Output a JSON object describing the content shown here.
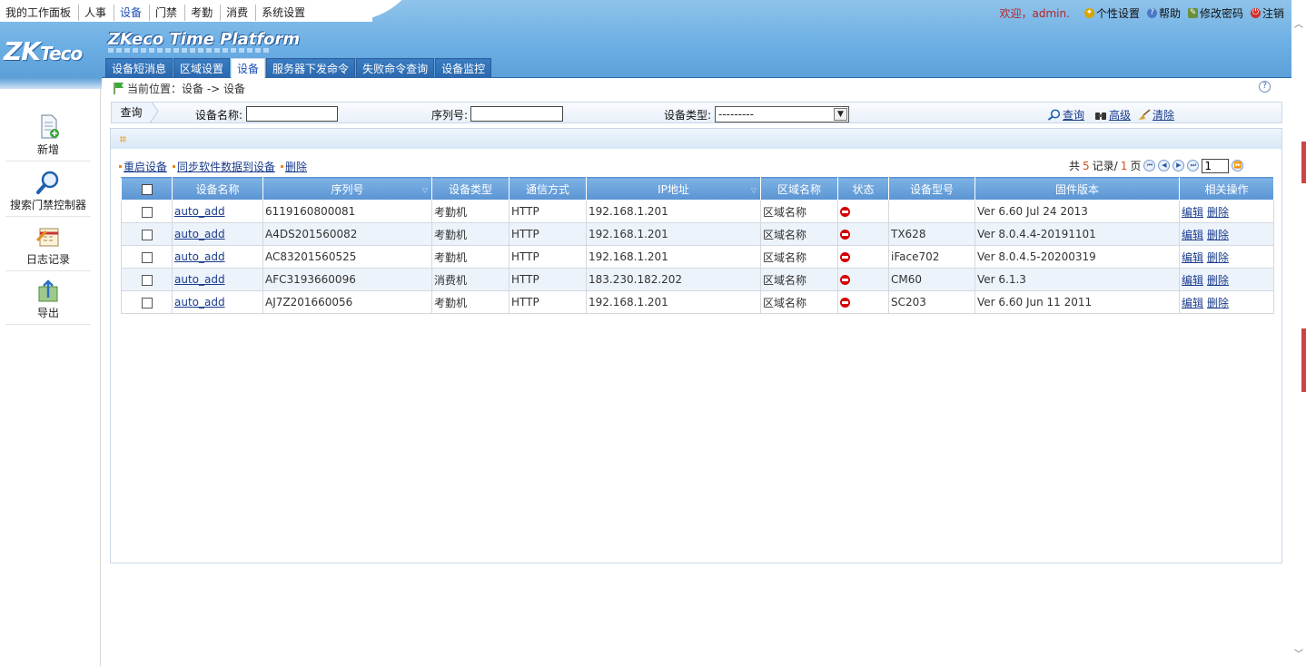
{
  "topnav": [
    "我的工作面板",
    "人事",
    "设备",
    "门禁",
    "考勤",
    "消费",
    "系统设置"
  ],
  "user": {
    "welcome": "欢迎，admin.",
    "links": [
      {
        "label": "个性设置",
        "icon": "personalize-icon",
        "color": "#d9a400"
      },
      {
        "label": "帮助",
        "icon": "help-icon",
        "color": "#4a78c8"
      },
      {
        "label": "修改密码",
        "icon": "password-edit-icon",
        "color": "#6a8f3a"
      },
      {
        "label": "注销",
        "icon": "logout-icon",
        "color": "#d0302a"
      }
    ]
  },
  "brand": {
    "logo": "ZKTeco",
    "platform_title": "ZKeco Time Platform"
  },
  "tabs": [
    {
      "label": "设备短消息",
      "active": false
    },
    {
      "label": "区域设置",
      "active": false
    },
    {
      "label": "设备",
      "active": true
    },
    {
      "label": "服务器下发命令",
      "active": false
    },
    {
      "label": "失败命令查询",
      "active": false
    },
    {
      "label": "设备监控",
      "active": false
    }
  ],
  "sidebar": [
    {
      "label": "新增",
      "icon": "add-document-icon"
    },
    {
      "label": "搜索门禁控制器",
      "icon": "search-icon"
    },
    {
      "label": "日志记录",
      "icon": "log-calendar-icon"
    },
    {
      "label": "导出",
      "icon": "export-icon"
    }
  ],
  "breadcrumb": "当前位置：设备 -> 设备",
  "search": {
    "tag": "查询",
    "device_name_label": "设备名称:",
    "device_name_value": "",
    "serial_label": "序列号:",
    "serial_value": "",
    "device_type_label": "设备类型:",
    "device_type_value": "---------",
    "query_label": "查询",
    "advanced_label": "高级",
    "clear_label": "清除"
  },
  "ops": [
    "重启设备",
    "同步软件数据到设备",
    "删除"
  ],
  "pager": {
    "prefix": "共",
    "total": "5",
    "records": "记录/",
    "pages": "1",
    "page_suffix": "页",
    "current": "1"
  },
  "table": {
    "columns": [
      "设备名称",
      "序列号",
      "设备类型",
      "通信方式",
      "IP地址",
      "区域名称",
      "状态",
      "设备型号",
      "固件版本",
      "相关操作"
    ],
    "rows": [
      {
        "name": "auto_add",
        "serial": "6119160800081",
        "type": "考勤机",
        "comm": "HTTP",
        "ip": "192.168.1.201",
        "area": "区域名称",
        "model": "",
        "firmware": "Ver 6.60 Jul 24 2013",
        "edit": "编辑",
        "del": "删除"
      },
      {
        "name": "auto_add",
        "serial": "A4DS201560082",
        "type": "考勤机",
        "comm": "HTTP",
        "ip": "192.168.1.201",
        "area": "区域名称",
        "model": "TX628",
        "firmware": "Ver 8.0.4.4-20191101",
        "edit": "编辑",
        "del": "删除"
      },
      {
        "name": "auto_add",
        "serial": "AC83201560525",
        "type": "考勤机",
        "comm": "HTTP",
        "ip": "192.168.1.201",
        "area": "区域名称",
        "model": "iFace702",
        "firmware": "Ver 8.0.4.5-20200319",
        "edit": "编辑",
        "del": "删除"
      },
      {
        "name": "auto_add",
        "serial": "AFC3193660096",
        "type": "消费机",
        "comm": "HTTP",
        "ip": "183.230.182.202",
        "area": "区域名称",
        "model": "CM60",
        "firmware": "Ver 6.1.3",
        "edit": "编辑",
        "del": "删除"
      },
      {
        "name": "auto_add",
        "serial": "AJ7Z201660056",
        "type": "考勤机",
        "comm": "HTTP",
        "ip": "192.168.1.201",
        "area": "区域名称",
        "model": "SC203",
        "firmware": "Ver 6.60 Jun 11 2011",
        "edit": "编辑",
        "del": "删除"
      }
    ]
  },
  "colors": {
    "status_offline": "#d40000",
    "header_blue": "#5d9fd8",
    "pager_number": "#d0501a"
  }
}
